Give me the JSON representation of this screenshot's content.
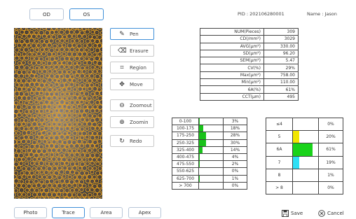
{
  "eye_tabs": [
    {
      "label": "OD",
      "active": false
    },
    {
      "label": "OS",
      "active": true
    }
  ],
  "header": {
    "pid_label": "PID : 202106280001",
    "name_label": "Name : Jason"
  },
  "tools": [
    {
      "label": "Pen",
      "icon": "pen-icon",
      "glyph": "✎",
      "active": true
    },
    {
      "label": "Erasure",
      "icon": "eraser-icon",
      "glyph": "⌫",
      "active": false
    },
    {
      "label": "Region",
      "icon": "region-icon",
      "glyph": "⌗",
      "active": false
    },
    {
      "label": "Move",
      "icon": "move-icon",
      "glyph": "✥",
      "active": false
    },
    {
      "label": "Zoomout",
      "icon": "zoom-out-icon",
      "glyph": "⊖",
      "active": false
    },
    {
      "label": "Zoomin",
      "icon": "zoom-in-icon",
      "glyph": "⊕",
      "active": false
    },
    {
      "label": "Redo",
      "icon": "redo-icon",
      "glyph": "↻",
      "active": false
    }
  ],
  "stats": [
    {
      "label": "NUM(Pieces)",
      "value": "309"
    },
    {
      "label": "CD(/mm²)",
      "value": "3029"
    },
    {
      "label": "AVG(μm²)",
      "value": "330.00"
    },
    {
      "label": "SD(μm²)",
      "value": "96.20"
    },
    {
      "label": "SEM(μm²)",
      "value": "5.47"
    },
    {
      "label": "CV(%)",
      "value": "29%"
    },
    {
      "label": "Max(μm²)",
      "value": "758.00"
    },
    {
      "label": "Min(μm²)",
      "value": "110.00"
    },
    {
      "label": "6A(%)",
      "value": "61%"
    },
    {
      "label": "CCT(μm)",
      "value": "495"
    }
  ],
  "area_distribution": [
    {
      "range": "0-100",
      "percent": "3%",
      "fraction": 0.03
    },
    {
      "range": "100-175",
      "percent": "18%",
      "fraction": 0.18
    },
    {
      "range": "175-250",
      "percent": "28%",
      "fraction": 0.28
    },
    {
      "range": "250-325",
      "percent": "30%",
      "fraction": 0.3
    },
    {
      "range": "325-400",
      "percent": "14%",
      "fraction": 0.14
    },
    {
      "range": "400-475",
      "percent": "4%",
      "fraction": 0.04
    },
    {
      "range": "475-550",
      "percent": "2%",
      "fraction": 0.02
    },
    {
      "range": "550-625",
      "percent": "0%",
      "fraction": 0.0
    },
    {
      "range": "625-700",
      "percent": "1%",
      "fraction": 0.01
    },
    {
      "range": "> 700",
      "percent": "0%",
      "fraction": 0.0
    }
  ],
  "neighbor_distribution": [
    {
      "sides": "≤4",
      "percent": "0%",
      "fraction": 0.0,
      "color": "#ffffff"
    },
    {
      "sides": "5",
      "percent": "20%",
      "fraction": 0.2,
      "color": "#f2e600"
    },
    {
      "sides": "6A",
      "percent": "61%",
      "fraction": 0.61,
      "color": "#19d31a"
    },
    {
      "sides": "7",
      "percent": "19%",
      "fraction": 0.19,
      "color": "#2fe0f5"
    },
    {
      "sides": "8",
      "percent": "1%",
      "fraction": 0.01,
      "color": "#ffffff"
    },
    {
      "sides": "> 8",
      "percent": "0%",
      "fraction": 0.0,
      "color": "#ffffff"
    }
  ],
  "colors": {
    "accent": "#3f8fd8",
    "area_bar": "#19c21a",
    "marker": "#f0a21a"
  },
  "bottom_tabs": [
    {
      "label": "Photo",
      "active": false
    },
    {
      "label": "Trace",
      "active": true
    },
    {
      "label": "Area",
      "active": false
    },
    {
      "label": "Apex",
      "active": false
    }
  ],
  "actions": {
    "save_label": "Save",
    "cancel_label": "Cancel"
  }
}
